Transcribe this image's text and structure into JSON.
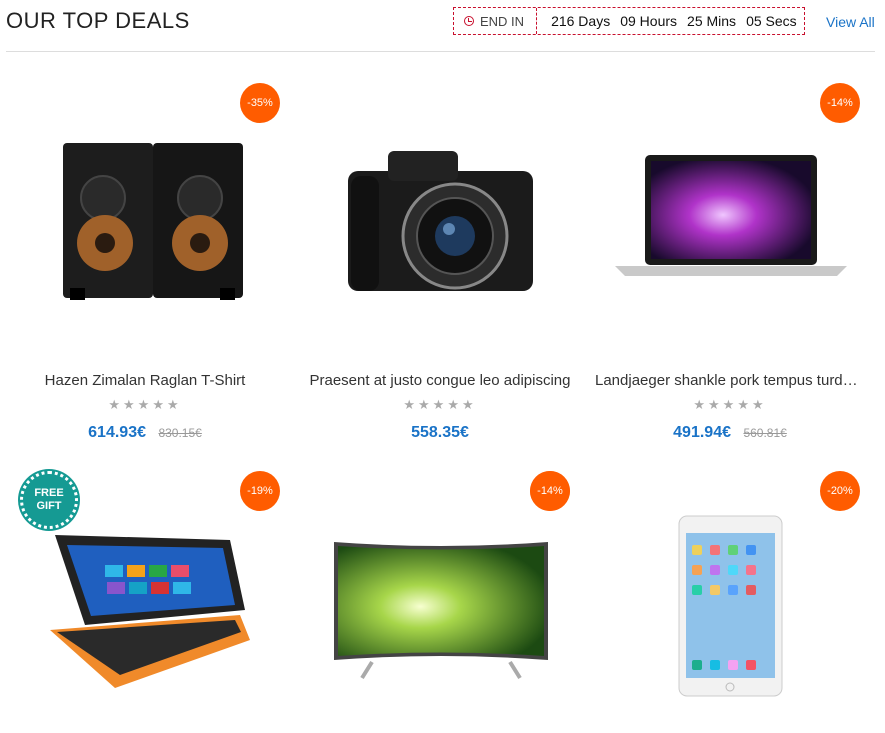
{
  "header": {
    "title": "OUR TOP DEALS",
    "end_in": "END IN",
    "days": "216 Days",
    "hours": "09 Hours",
    "mins": "25 Mins",
    "secs": "05 Secs",
    "view_all": "View All"
  },
  "products": [
    {
      "badge": "-35%",
      "name": "Hazen Zimalan Raglan T-Shirt",
      "stars": "★★★★★",
      "price": "614.93€",
      "old_price": "830.15€"
    },
    {
      "badge": "-14%",
      "name": "Praesent at justo congue leo adipiscing",
      "stars": "★★★★★",
      "price": "558.35€",
      "old_price": ""
    },
    {
      "badge": "-14%",
      "name": "Landjaeger shankle pork tempus turducken",
      "stars": "★★★★★",
      "price": "491.94€",
      "old_price": "560.81€"
    },
    {
      "badge": "-19%"
    },
    {
      "badge": "-14%"
    },
    {
      "badge": "-20%"
    }
  ],
  "gift_label": "FREE GIFT",
  "colors": {
    "badge": "#ff5c00",
    "price": "#1a73c7",
    "countdown_border": "#c8102e"
  }
}
